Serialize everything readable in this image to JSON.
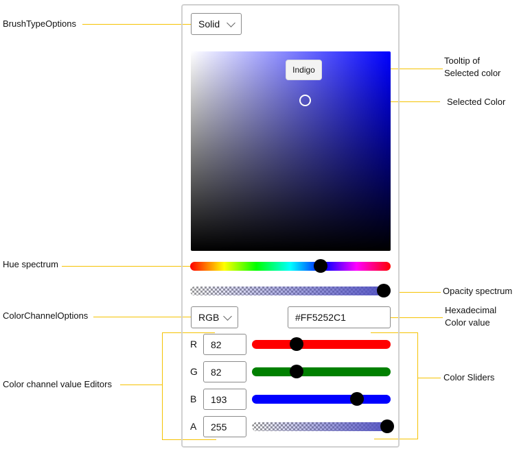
{
  "annotations": {
    "brush_type": "BrushTypeOptions",
    "tooltip": "Tooltip of\nSelected color",
    "selected_color": "Selected Color",
    "hue": "Hue spectrum",
    "opacity": "Opacity spectrum",
    "channel_options": "ColorChannelOptions",
    "hex": "Hexadecimal\nColor value",
    "editors": "Color channel value Editors",
    "sliders": "Color Sliders"
  },
  "colors": {
    "annotation_line": "#f5c200",
    "selected": "#5252C1"
  },
  "picker": {
    "brush_type": "Solid",
    "tooltip": "Indigo",
    "hue_position_pct": 65,
    "opacity_pct": 100,
    "channel_mode": "RGB",
    "hex": "#FF5252C1",
    "channels": [
      {
        "label": "R",
        "value": "82",
        "max": 255,
        "color": "#ff0000"
      },
      {
        "label": "G",
        "value": "82",
        "max": 255,
        "color": "#008000"
      },
      {
        "label": "B",
        "value": "193",
        "max": 255,
        "color": "#0000ff"
      },
      {
        "label": "A",
        "value": "255",
        "max": 255,
        "color": "checker"
      }
    ]
  }
}
